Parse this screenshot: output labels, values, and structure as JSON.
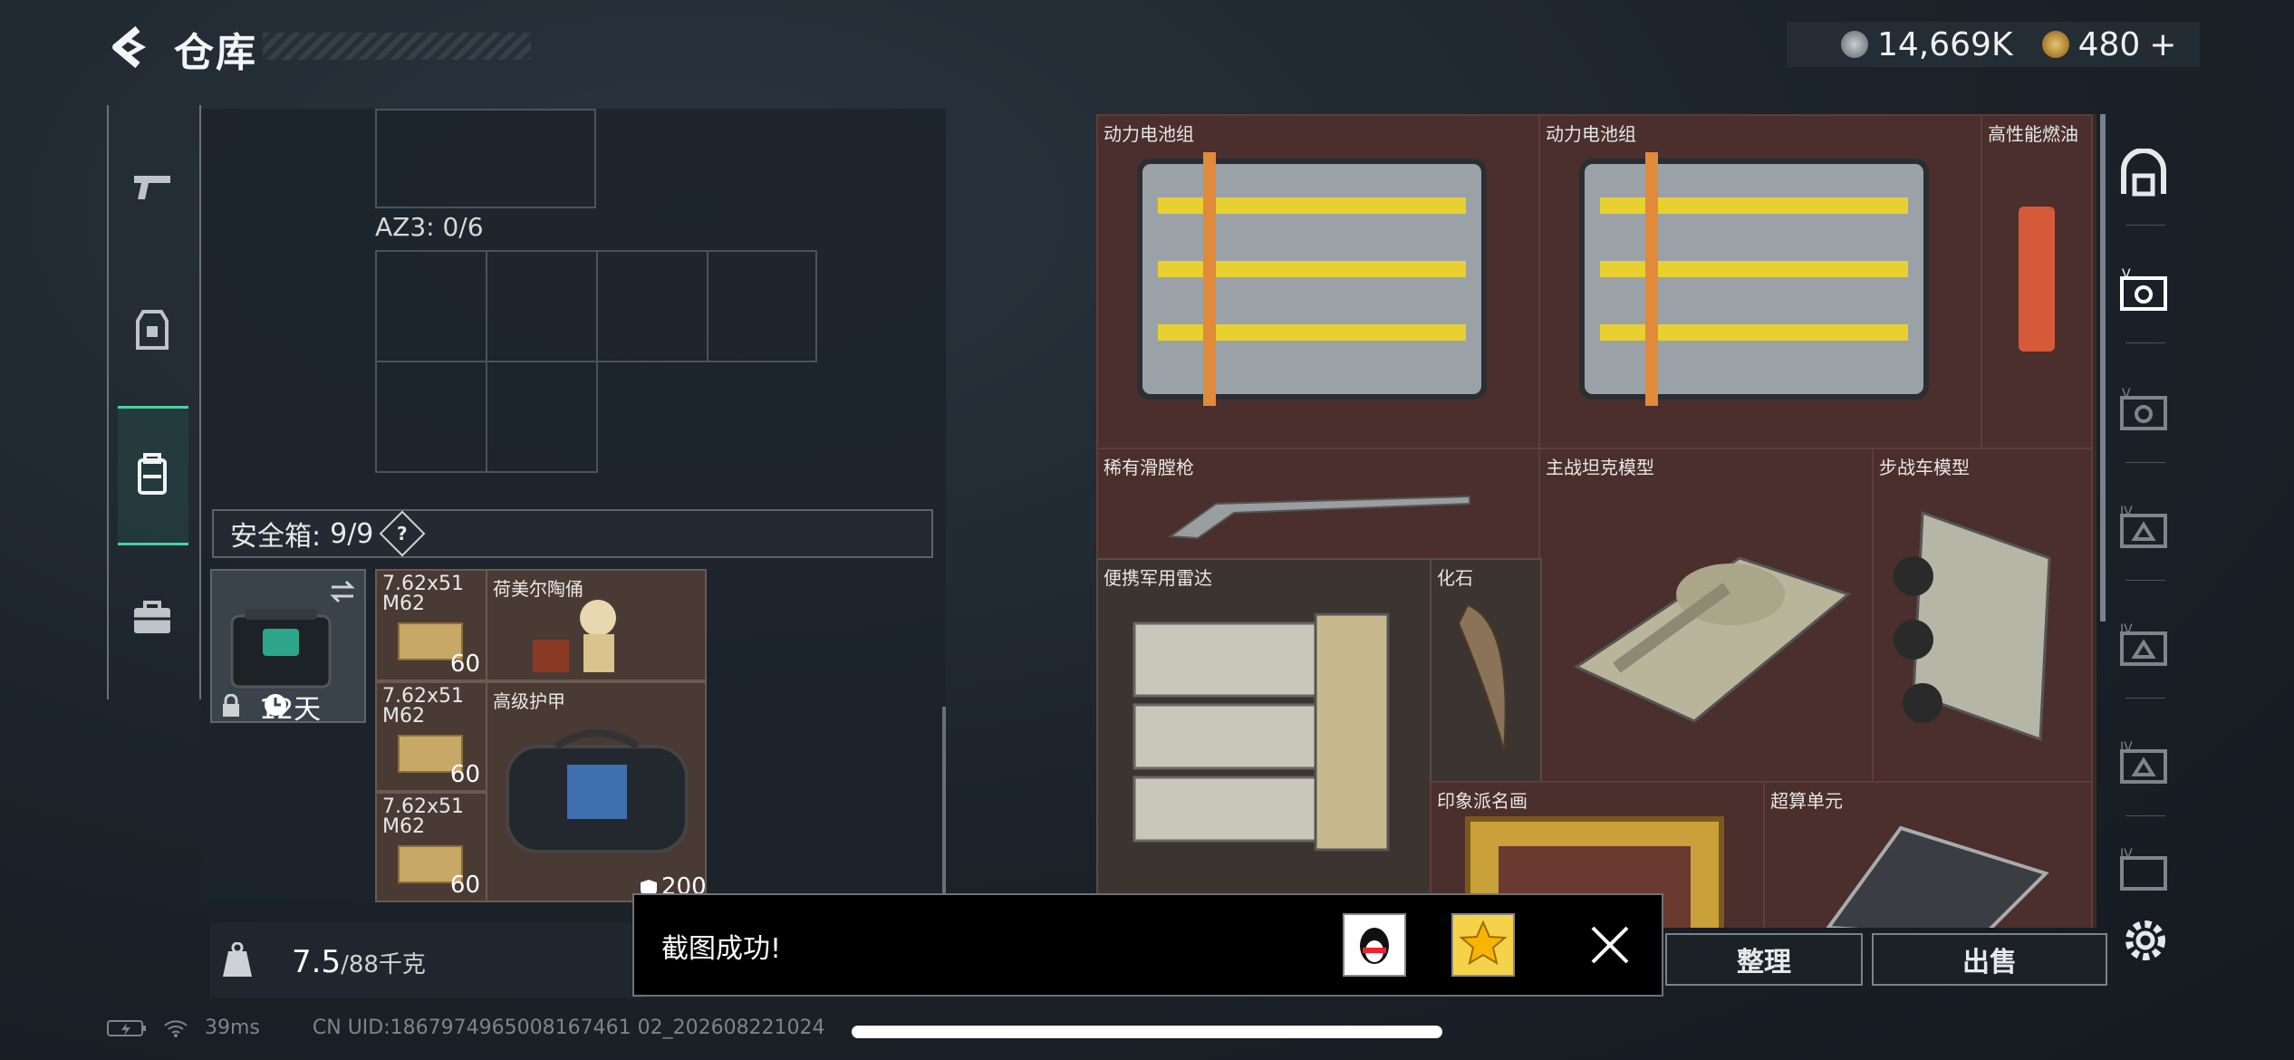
{
  "header": {
    "title": "仓库",
    "back_icon": "back-arrow-icon"
  },
  "currency": {
    "silver": "14,669K",
    "gold": "480",
    "gold_plus": "+"
  },
  "left_nav": [
    {
      "id": "weapons",
      "icon": "pistol-icon"
    },
    {
      "id": "armor",
      "icon": "vest-icon"
    },
    {
      "id": "backpack",
      "icon": "backpack-icon",
      "active": true
    },
    {
      "id": "briefcase",
      "icon": "briefcase-icon"
    }
  ],
  "container": {
    "slot_label": "AZ3: 0/6"
  },
  "safe_box": {
    "label": "安全箱:",
    "capacity": "9/9",
    "help": "?",
    "days": "12天"
  },
  "safe_items": [
    {
      "label": "7.62x51 M62",
      "count": "60"
    },
    {
      "label": "7.62x51 M62",
      "count": "60"
    },
    {
      "label": "7.62x51 M62",
      "count": "60"
    }
  ],
  "safe_large_items": [
    {
      "name": "荷美尔陶俑"
    },
    {
      "name": "高级护甲",
      "durability": "200"
    }
  ],
  "weight": {
    "value": "7.5",
    "max": "/88千克"
  },
  "stash": [
    {
      "name": "动力电池组"
    },
    {
      "name": "动力电池组"
    },
    {
      "name": "高性能燃油"
    },
    {
      "name": "稀有滑膛枪"
    },
    {
      "name": "主战坦克模型"
    },
    {
      "name": "步战车模型"
    },
    {
      "name": "便携军用雷达"
    },
    {
      "name": "化石"
    },
    {
      "name": "印象派名画"
    },
    {
      "name": "超算单元"
    }
  ],
  "right_nav": [
    {
      "id": "all",
      "icon": "arch-icon"
    },
    {
      "id": "tier-v-a",
      "icon": "tier-v-icon",
      "tier": "V"
    },
    {
      "id": "tier-v-b",
      "icon": "tier-v-icon",
      "tier": "V"
    },
    {
      "id": "tier-iv-a",
      "icon": "tier-iv-icon",
      "tier": "IV"
    },
    {
      "id": "tier-iv-b",
      "icon": "tier-iv-icon",
      "tier": "IV"
    },
    {
      "id": "tier-iv-c",
      "icon": "tier-iv-icon",
      "tier": "IV"
    },
    {
      "id": "tier-iv-d",
      "icon": "tier-iv-icon",
      "tier": "IV"
    }
  ],
  "buttons": {
    "sort": "整理",
    "sell": "出售"
  },
  "toast": {
    "message": "截图成功!"
  },
  "status": {
    "ping": "39ms",
    "uid": "CN UID:1867974965008167461 02_202608221024"
  },
  "colors": {
    "accent": "#45d2a2",
    "stash_bg": "#4a2f2c",
    "toast_bg": "#000000"
  }
}
